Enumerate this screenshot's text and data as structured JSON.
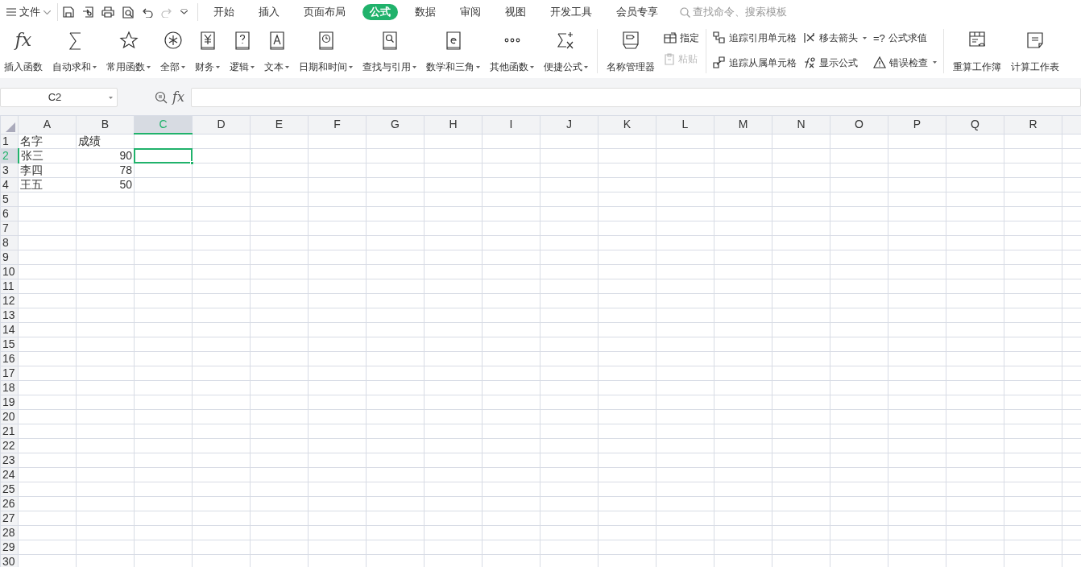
{
  "menu": {
    "file_label": "文件",
    "tabs": [
      {
        "label": "开始",
        "selected": false
      },
      {
        "label": "插入",
        "selected": false
      },
      {
        "label": "页面布局",
        "selected": false
      },
      {
        "label": "公式",
        "selected": true
      },
      {
        "label": "数据",
        "selected": false
      },
      {
        "label": "审阅",
        "selected": false
      },
      {
        "label": "视图",
        "selected": false
      },
      {
        "label": "开发工具",
        "selected": false
      },
      {
        "label": "会员专享",
        "selected": false
      }
    ],
    "search": {
      "placeholder": "查找命令、搜索模板"
    }
  },
  "ribbon": {
    "function_buttons": [
      {
        "label": "插入函数",
        "dropdown": false,
        "glyph": "fx"
      },
      {
        "label": "自动求和",
        "dropdown": true
      },
      {
        "label": "常用函数",
        "dropdown": true
      },
      {
        "label": "全部",
        "dropdown": true
      },
      {
        "label": "财务",
        "dropdown": true
      },
      {
        "label": "逻辑",
        "dropdown": true
      },
      {
        "label": "文本",
        "dropdown": true
      },
      {
        "label": "日期和时间",
        "dropdown": true
      },
      {
        "label": "查找与引用",
        "dropdown": true
      },
      {
        "label": "数学和三角",
        "dropdown": true
      },
      {
        "label": "其他函数",
        "dropdown": true
      },
      {
        "label": "便捷公式",
        "dropdown": true
      }
    ],
    "name_manager": {
      "label": "名称管理器"
    },
    "name_small": [
      {
        "label": "指定",
        "disabled": false
      },
      {
        "label": "粘贴",
        "disabled": true
      }
    ],
    "audit_items": [
      {
        "label": "追踪引用单元格",
        "dropdown": false
      },
      {
        "label": "追踪从属单元格",
        "dropdown": false
      },
      {
        "label": "移去箭头",
        "dropdown": true
      },
      {
        "label": "显示公式",
        "dropdown": false
      },
      {
        "label": "公式求值",
        "dropdown": false,
        "glyph": "=?"
      },
      {
        "label": "错误检查",
        "dropdown": true
      }
    ],
    "calc_buttons": [
      {
        "label": "重算工作簿"
      },
      {
        "label": "计算工作表"
      }
    ]
  },
  "formula_bar": {
    "name_box": "C2",
    "fx": "fx"
  },
  "sheet": {
    "columns": [
      {
        "label": "A",
        "selected": false
      },
      {
        "label": "B",
        "selected": false
      },
      {
        "label": "C",
        "selected": true
      },
      {
        "label": "D",
        "selected": false
      },
      {
        "label": "E",
        "selected": false
      },
      {
        "label": "F",
        "selected": false
      },
      {
        "label": "G",
        "selected": false
      },
      {
        "label": "H",
        "selected": false
      },
      {
        "label": "I",
        "selected": false
      },
      {
        "label": "J",
        "selected": false
      },
      {
        "label": "K",
        "selected": false
      },
      {
        "label": "L",
        "selected": false
      },
      {
        "label": "M",
        "selected": false
      },
      {
        "label": "N",
        "selected": false
      },
      {
        "label": "O",
        "selected": false
      },
      {
        "label": "P",
        "selected": false
      },
      {
        "label": "Q",
        "selected": false
      },
      {
        "label": "R",
        "selected": false
      }
    ],
    "rows": [
      {
        "label": "1",
        "selected": false,
        "cells": [
          {
            "text": "名字",
            "kind": "text"
          },
          {
            "text": "成绩",
            "kind": "text"
          }
        ]
      },
      {
        "label": "2",
        "selected": true,
        "cells": [
          {
            "text": "张三",
            "kind": "text"
          },
          {
            "text": "90",
            "kind": "number"
          }
        ]
      },
      {
        "label": "3",
        "selected": false,
        "cells": [
          {
            "text": "李四",
            "kind": "text"
          },
          {
            "text": "78",
            "kind": "number"
          }
        ]
      },
      {
        "label": "4",
        "selected": false,
        "cells": [
          {
            "text": "王五",
            "kind": "text"
          },
          {
            "text": "50",
            "kind": "number"
          }
        ]
      },
      {
        "label": "5",
        "selected": false,
        "cells": []
      },
      {
        "label": "6",
        "selected": false,
        "cells": []
      },
      {
        "label": "7",
        "selected": false,
        "cells": []
      },
      {
        "label": "8",
        "selected": false,
        "cells": []
      },
      {
        "label": "9",
        "selected": false,
        "cells": []
      },
      {
        "label": "10",
        "selected": false,
        "cells": []
      },
      {
        "label": "11",
        "selected": false,
        "cells": []
      },
      {
        "label": "12",
        "selected": false,
        "cells": []
      },
      {
        "label": "13",
        "selected": false,
        "cells": []
      },
      {
        "label": "14",
        "selected": false,
        "cells": []
      },
      {
        "label": "15",
        "selected": false,
        "cells": []
      },
      {
        "label": "16",
        "selected": false,
        "cells": []
      },
      {
        "label": "17",
        "selected": false,
        "cells": []
      },
      {
        "label": "18",
        "selected": false,
        "cells": []
      },
      {
        "label": "19",
        "selected": false,
        "cells": []
      },
      {
        "label": "20",
        "selected": false,
        "cells": []
      },
      {
        "label": "21",
        "selected": false,
        "cells": []
      },
      {
        "label": "22",
        "selected": false,
        "cells": []
      },
      {
        "label": "23",
        "selected": false,
        "cells": []
      },
      {
        "label": "24",
        "selected": false,
        "cells": []
      },
      {
        "label": "25",
        "selected": false,
        "cells": []
      },
      {
        "label": "26",
        "selected": false,
        "cells": []
      },
      {
        "label": "27",
        "selected": false,
        "cells": []
      },
      {
        "label": "28",
        "selected": false,
        "cells": []
      },
      {
        "label": "29",
        "selected": false,
        "cells": []
      },
      {
        "label": "30",
        "selected": false,
        "cells": []
      }
    ]
  }
}
